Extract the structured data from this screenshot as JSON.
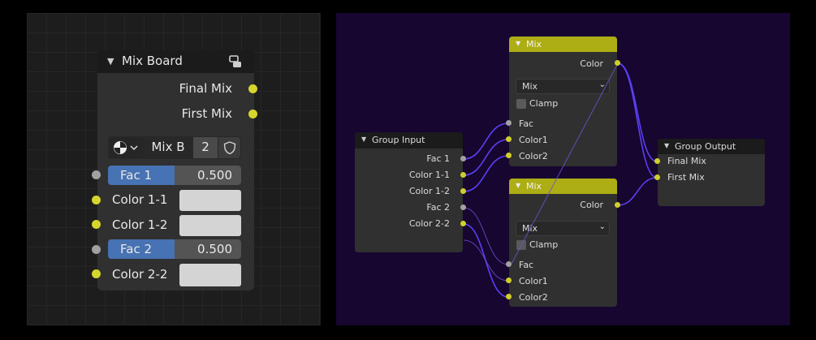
{
  "left_node": {
    "title": "Mix Board",
    "outputs": [
      "Final Mix",
      "First Mix"
    ],
    "selector": {
      "name": "Mix B",
      "users": "2"
    },
    "inputs": [
      {
        "label": "Fac 1",
        "value": "0.500",
        "kind": "slider"
      },
      {
        "label": "Color 1-1",
        "kind": "color"
      },
      {
        "label": "Color 1-2",
        "kind": "color"
      },
      {
        "label": "Fac 2",
        "value": "0.500",
        "kind": "slider"
      },
      {
        "label": "Color 2-2",
        "kind": "color"
      }
    ]
  },
  "group_input": {
    "title": "Group Input",
    "outputs": [
      "Fac 1",
      "Color 1-1",
      "Color 1-2",
      "Fac 2",
      "Color 2-2"
    ]
  },
  "mix_top": {
    "title": "Mix",
    "output": "Color",
    "blend_mode": "Mix",
    "clamp_label": "Clamp",
    "inputs": [
      "Fac",
      "Color1",
      "Color2"
    ]
  },
  "mix_bottom": {
    "title": "Mix",
    "output": "Color",
    "blend_mode": "Mix",
    "clamp_label": "Clamp",
    "inputs": [
      "Fac",
      "Color1",
      "Color2"
    ]
  },
  "group_output": {
    "title": "Group Output",
    "inputs": [
      "Final Mix",
      "First Mix"
    ]
  },
  "colors": {
    "socket_yellow": "#d5d52d",
    "socket_gray": "#a1a1a1",
    "wire": "#5b3ff2",
    "mix_header": "#adad15"
  }
}
